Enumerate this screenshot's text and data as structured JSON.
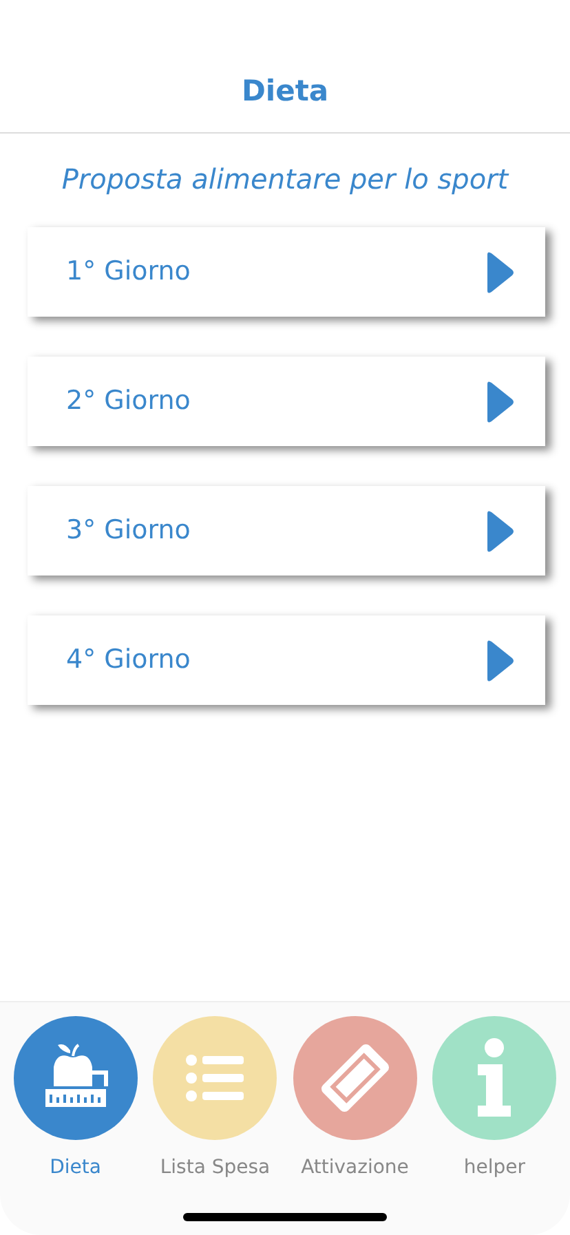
{
  "header": {
    "title": "Dieta"
  },
  "subtitle": "Proposta alimentare per lo sport",
  "days": [
    {
      "label": "1° Giorno"
    },
    {
      "label": "2° Giorno"
    },
    {
      "label": "3° Giorno"
    },
    {
      "label": "4° Giorno"
    }
  ],
  "tabs": [
    {
      "label": "Dieta",
      "kind": "diet",
      "color": "#3a87cc",
      "selected": true
    },
    {
      "label": "Lista Spesa",
      "kind": "list",
      "color": "#f4dfa4",
      "selected": false
    },
    {
      "label": "Attivazione",
      "kind": "ticket",
      "color": "#e6a69c",
      "selected": false
    },
    {
      "label": "helper",
      "kind": "info",
      "color": "#a0e1c6",
      "selected": false
    }
  ]
}
